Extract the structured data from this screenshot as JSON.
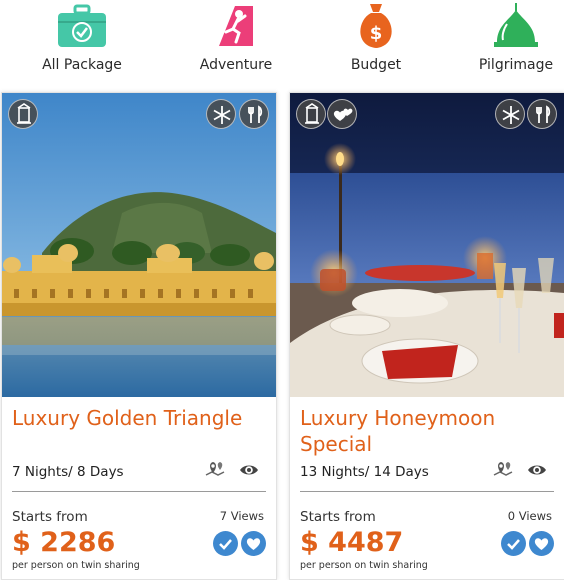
{
  "categories": [
    {
      "label": "All Package",
      "icon": "briefcase-check-icon",
      "color": "#45c7a7"
    },
    {
      "label": "Adventure",
      "icon": "climber-icon",
      "color": "#ec3e79"
    },
    {
      "label": "Budget",
      "icon": "money-bag-icon",
      "color": "#e8641e"
    },
    {
      "label": "Pilgrimage",
      "icon": "temple-dome-icon",
      "color": "#2fb05a"
    }
  ],
  "packages": [
    {
      "title": "Luxury Golden Triangle",
      "duration": "7 Nights/ 8 Days",
      "starts_label": "Starts from",
      "views": "7 Views",
      "price": "$ 2286",
      "price_note": "per person on twin sharing",
      "image": "jal-mahal-palace-on-lake",
      "badges": [
        "monument-icon",
        "snowflake-icon",
        "cutlery-icon"
      ]
    },
    {
      "title": "Luxury Honeymoon Special",
      "duration": "13 Nights/ 14 Days",
      "starts_label": "Starts from",
      "views": "0 Views",
      "price": "$ 4487",
      "price_note": "per person on twin sharing",
      "image": "candlelit-beach-dinner",
      "badges": [
        "monument-icon",
        "hearts-icon",
        "snowflake-icon",
        "cutlery-icon"
      ]
    }
  ],
  "colors": {
    "accent": "#e0611a",
    "action_blue": "#3e88cf",
    "text": "#222222"
  }
}
